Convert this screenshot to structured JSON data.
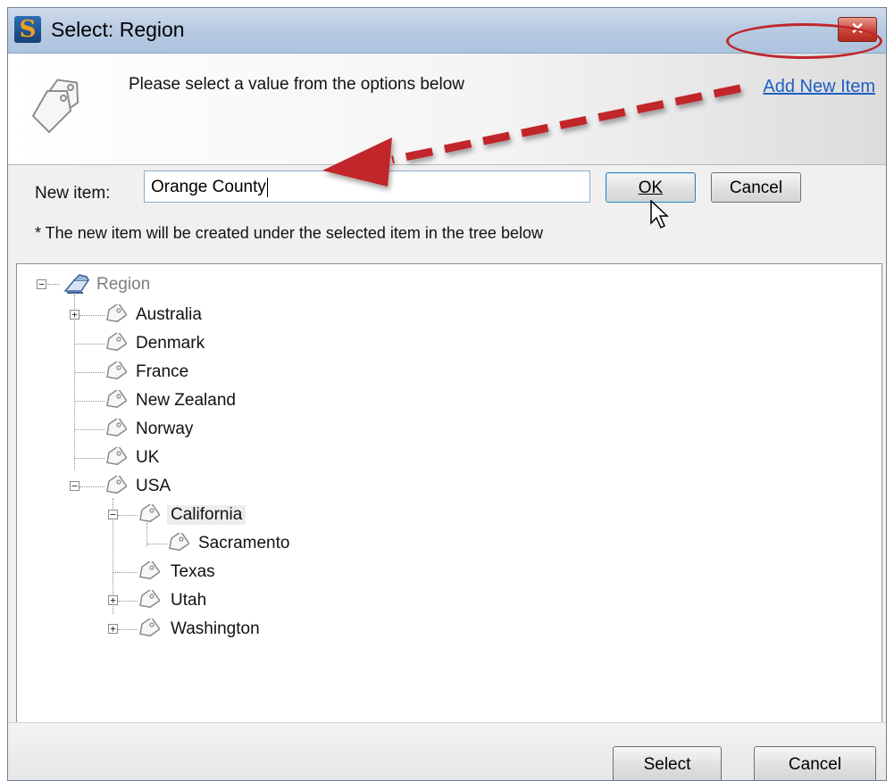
{
  "window": {
    "title": "Select: Region",
    "close_glyph": "✕"
  },
  "header": {
    "message": "Please select a value from the options below",
    "add_new_link": "Add New Item"
  },
  "new_item": {
    "label": "New item:",
    "value": "Orange County",
    "ok_label": "OK",
    "cancel_label": "Cancel",
    "note": "* The new item will be created under the selected item in the tree below"
  },
  "tree": {
    "root": "Region",
    "items": {
      "australia": "Australia",
      "denmark": "Denmark",
      "france": "France",
      "new_zealand": "New Zealand",
      "norway": "Norway",
      "uk": "UK",
      "usa": "USA",
      "california": "California",
      "sacramento": "Sacramento",
      "texas": "Texas",
      "utah": "Utah",
      "washington": "Washington"
    },
    "selected": "California"
  },
  "footer": {
    "select_label": "Select",
    "cancel_label": "Cancel"
  },
  "colors": {
    "accent_red": "#c0262a",
    "link_blue": "#1e5fc2",
    "title_bar": "#b9cbe2"
  }
}
